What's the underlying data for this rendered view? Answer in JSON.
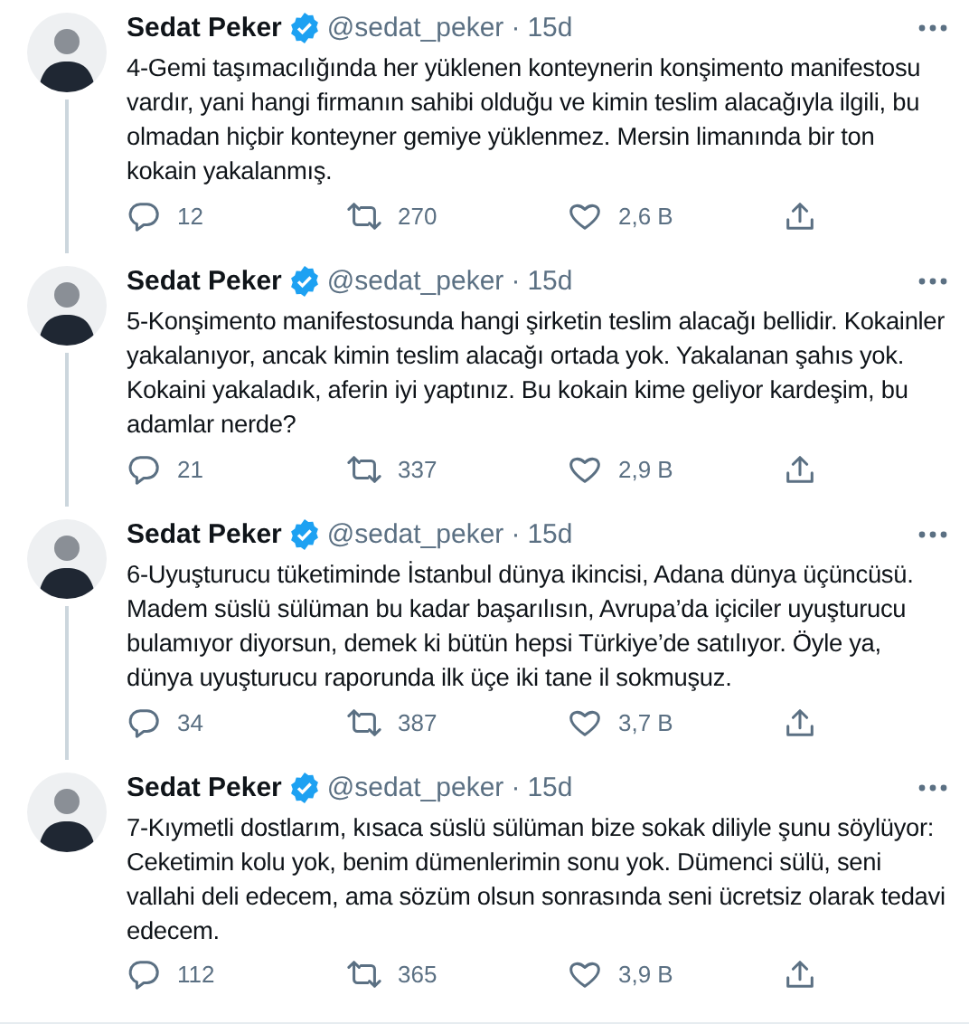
{
  "tweets": [
    {
      "name": "Sedat Peker",
      "verified": true,
      "handle": "@sedat_peker",
      "separator": "·",
      "time": "15d",
      "text": "4-Gemi taşımacılığında her yüklenen konteynerin konşimento manifestosu vardır, yani hangi firmanın sahibi olduğu ve kimin teslim alacağıyla ilgili, bu olmadan hiçbir konteyner gemiye yüklenmez. Mersin limanında bir ton kokain yakalanmış.",
      "replies": "12",
      "retweets": "270",
      "likes": "2,6 B",
      "thread_continues": true
    },
    {
      "name": "Sedat Peker",
      "verified": true,
      "handle": "@sedat_peker",
      "separator": "·",
      "time": "15d",
      "text": "5-Konşimento manifestosunda hangi şirketin teslim alacağı bellidir. Kokainler yakalanıyor, ancak kimin teslim alacağı ortada yok. Yakalanan şahıs yok. Kokaini yakaladık, aferin iyi yaptınız. Bu kokain kime geliyor kardeşim, bu adamlar nerde?",
      "replies": "21",
      "retweets": "337",
      "likes": "2,9 B",
      "thread_continues": true
    },
    {
      "name": "Sedat Peker",
      "verified": true,
      "handle": "@sedat_peker",
      "separator": "·",
      "time": "15d",
      "text": "6-Uyuşturucu tüketiminde İstanbul dünya ikincisi, Adana dünya üçüncüsü. Madem süslü sülüman bu kadar başarılısın, Avrupa’da içiciler uyuşturucu bulamıyor diyorsun, demek ki bütün hepsi Türkiye’de satılıyor. Öyle ya, dünya uyuşturucu raporunda ilk üçe iki tane il sokmuşuz.",
      "replies": "34",
      "retweets": "387",
      "likes": "3,7 B",
      "thread_continues": true
    },
    {
      "name": "Sedat Peker",
      "verified": true,
      "handle": "@sedat_peker",
      "separator": "·",
      "time": "15d",
      "text": "7-Kıymetli dostlarım, kısaca süslü sülüman bize sokak diliyle şunu söylüyor: Ceketimin kolu yok, benim dümenlerimin sonu yok. Dümenci sülü, seni vallahi deli edecem, ama sözüm olsun sonrasında seni ücretsiz olarak tedavi edecem.",
      "replies": "112",
      "retweets": "365",
      "likes": "3,9 B",
      "thread_continues": false
    }
  ]
}
